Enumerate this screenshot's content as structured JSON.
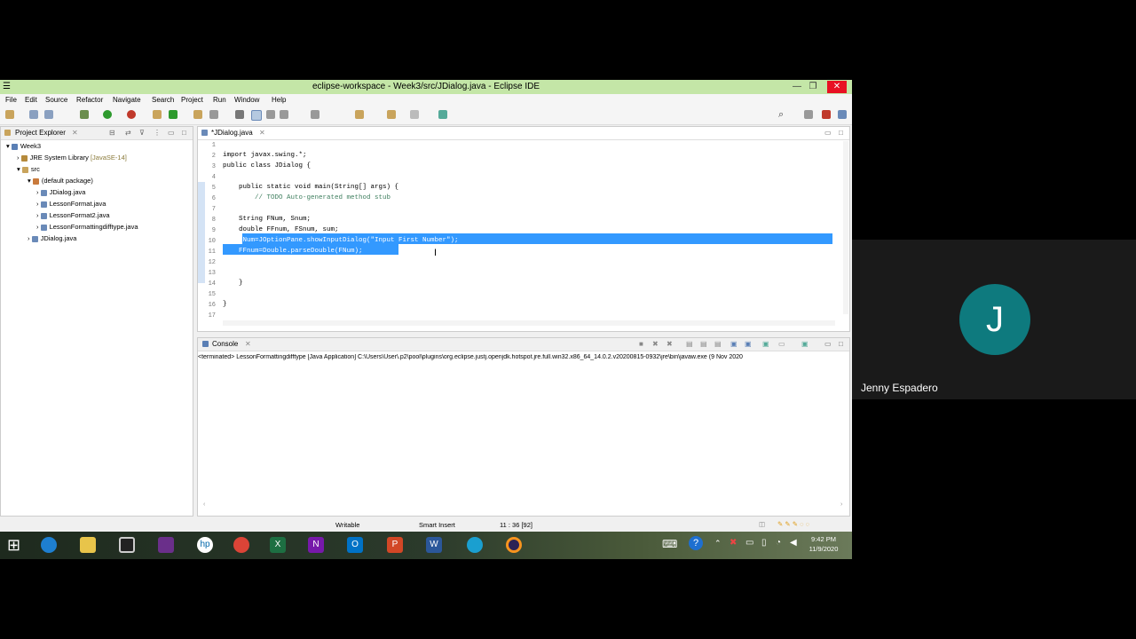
{
  "window": {
    "title": "eclipse-workspace - Week3/src/JDialog.java - Eclipse IDE",
    "menu": [
      "File",
      "Edit",
      "Source",
      "Refactor",
      "Navigate",
      "Search",
      "Project",
      "Run",
      "Window",
      "Help"
    ]
  },
  "project_explorer": {
    "tab_label": "Project Explorer",
    "items": [
      {
        "label": "Week3",
        "indent": 0
      },
      {
        "label": "JRE System Library",
        "suffix": "[JavaSE-14]",
        "indent": 1
      },
      {
        "label": "src",
        "indent": 1
      },
      {
        "label": "(default package)",
        "indent": 2
      },
      {
        "label": "JDialog.java",
        "indent": 3
      },
      {
        "label": "LessonFormat.java",
        "indent": 3
      },
      {
        "label": "LessonFormat2.java",
        "indent": 3
      },
      {
        "label": "LessonFormattingdifftype.java",
        "indent": 3
      },
      {
        "label": "JDialog.java",
        "indent": 1
      }
    ]
  },
  "editor": {
    "tab_label": "*JDialog.java",
    "lines": [
      {
        "n": "1",
        "text": ""
      },
      {
        "n": "2",
        "text": "import javax.swing.*;"
      },
      {
        "n": "3",
        "text": "public class JDialog {"
      },
      {
        "n": "4",
        "text": ""
      },
      {
        "n": "5",
        "text": "    public static void main(String[] args) {"
      },
      {
        "n": "6",
        "text": "        // TODO Auto-generated method stub"
      },
      {
        "n": "7",
        "text": ""
      },
      {
        "n": "8",
        "text": "    String FNum, Snum;"
      },
      {
        "n": "9",
        "text": "    double FFnum, FSnum, sum;"
      },
      {
        "n": "10",
        "text": "    FNum=JOptionPane.showInputDialog(\"Input First Number\");"
      },
      {
        "n": "11",
        "text": "    FFnum=Double.parseDouble(FNum);"
      },
      {
        "n": "12",
        "text": ""
      },
      {
        "n": "13",
        "text": ""
      },
      {
        "n": "14",
        "text": "    }"
      },
      {
        "n": "15",
        "text": ""
      },
      {
        "n": "16",
        "text": "}"
      },
      {
        "n": "17",
        "text": ""
      }
    ]
  },
  "console": {
    "tab_label": "Console",
    "status_line": "<terminated> LessonFormattingdifftype [Java Application] C:\\Users\\User\\.p2\\pool\\plugins\\org.eclipse.justj.openjdk.hotspot.jre.full.win32.x86_64_14.0.2.v20200815-0932\\jre\\bin\\javaw.exe (9 Nov 2020"
  },
  "statusbar": {
    "mode": "Writable",
    "insert": "Smart Insert",
    "position": "11 : 36 [92]"
  },
  "taskbar": {
    "time": "9:42 PM",
    "date": "11/9/2020"
  },
  "participant": {
    "initial": "J",
    "name": "Jenny Espadero",
    "avatar_color": "#0e7a7e"
  }
}
